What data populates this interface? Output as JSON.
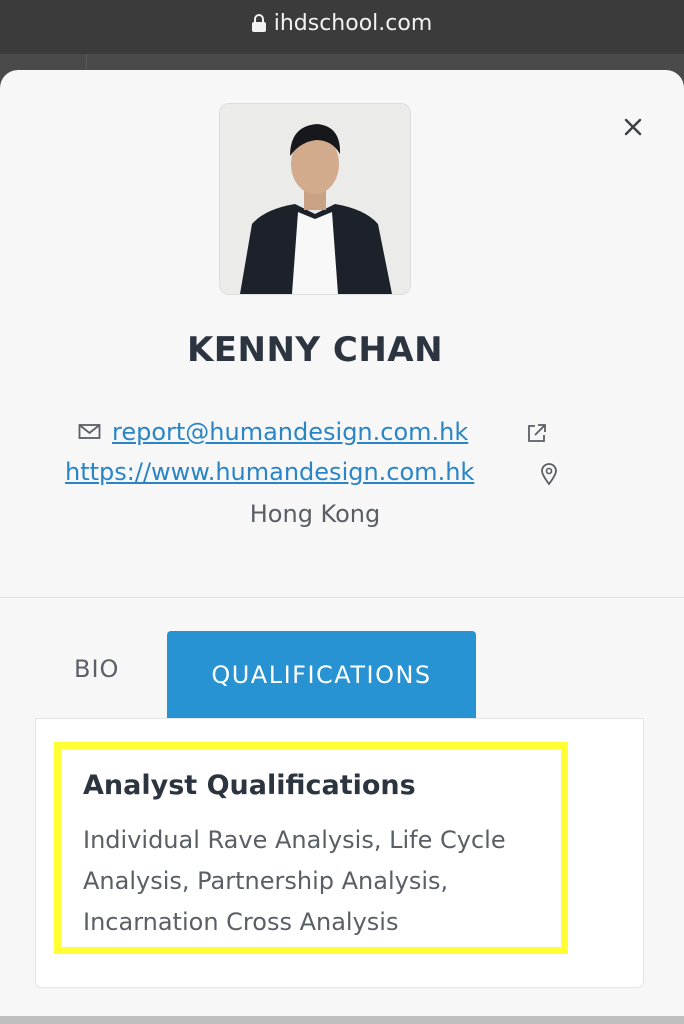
{
  "browser": {
    "url": "ihdschool.com"
  },
  "profile": {
    "name": "KENNY CHAN",
    "email": "report@humandesign.com.hk",
    "website": "https://www.humandesign.com.hk",
    "location": "Hong Kong"
  },
  "icons": {
    "lock": "lock-icon",
    "close": "close-icon",
    "email": "envelope-icon",
    "external": "external-link-icon",
    "location": "map-pin-icon"
  },
  "tabs": [
    {
      "label": "BIO",
      "active": false
    },
    {
      "label": "QUALIFICATIONS",
      "active": true
    }
  ],
  "qualifications": {
    "title": "Analyst Qualifications",
    "text": "Individual Rave Analysis, Life Cycle Analysis, Partnership Analysis, Incarnation Cross Analysis"
  },
  "colors": {
    "accent": "#2793d3",
    "link": "#2a85c7",
    "highlight": "#ffff33",
    "heading": "#2c3440"
  }
}
